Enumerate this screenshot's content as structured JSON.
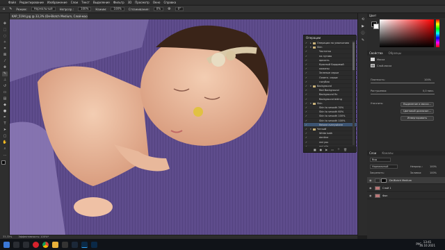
{
  "app": {
    "logo_text": "Ps"
  },
  "menu": [
    "Файл",
    "Редактирование",
    "Изображение",
    "Слои",
    "Текст",
    "Выделение",
    "Фильтр",
    "3D",
    "Просмотр",
    "Окно",
    "Справка"
  ],
  "options": {
    "mode_label": "Режим:",
    "mode_value": "Нормальный",
    "opacity_label": "Непрозр.:",
    "opacity_value": "100%",
    "flow_label": "Нажим:",
    "flow_value": "100%",
    "smooth_label": "Сглаживание:",
    "smooth_value": "0%",
    "angle_value": "0°"
  },
  "document": {
    "tab_title": "KAP_5194.jpg @ 33,3% (De-Blotch Medium, Слой-маска/16) *"
  },
  "status": {
    "zoom": "33,33%",
    "info": "Эффективность: 100%*"
  },
  "actions_panel": {
    "title": "Операции",
    "rows": [
      {
        "label": "Операции по умолчанию",
        "expanded": false,
        "folder": true
      },
      {
        "label": "Skin",
        "expanded": true,
        "folder": true
      },
      {
        "label": "Частотка",
        "expanded": false,
        "folder": false
      },
      {
        "label": "на пугово",
        "expanded": false,
        "folder": false
      },
      {
        "label": "яркость",
        "expanded": false,
        "folder": false
      },
      {
        "label": "Красный Бордовый",
        "expanded": false,
        "folder": false
      },
      {
        "label": "кожаны",
        "expanded": false,
        "folder": false
      },
      {
        "label": "Зеленые серые",
        "expanded": false,
        "folder": false
      },
      {
        "label": "Осветл. серые",
        "expanded": false,
        "folder": false
      },
      {
        "label": "голубая",
        "expanded": false,
        "folder": false
      },
      {
        "label": "Background",
        "expanded": true,
        "folder": true
      },
      {
        "label": "Red Background",
        "expanded": false,
        "folder": false
      },
      {
        "label": "Background fix",
        "expanded": false,
        "folder": false
      },
      {
        "label": "Background biding",
        "expanded": false,
        "folder": false
      },
      {
        "label": "Skin",
        "expanded": true,
        "folder": true
      },
      {
        "label": "Skin to smooth 30%",
        "expanded": false,
        "folder": false
      },
      {
        "label": "Skin to smooth 60%",
        "expanded": false,
        "folder": false
      },
      {
        "label": "Skin to smooth 100%",
        "expanded": false,
        "folder": false
      },
      {
        "label": "Skin to smooth 100%",
        "expanded": false,
        "folder": false
      },
      {
        "label": "Retone everywhere",
        "expanded": false,
        "folder": false,
        "selected": true
      },
      {
        "label": "Четкий",
        "expanded": true,
        "folder": true
      },
      {
        "label": "White bath",
        "expanded": false,
        "folder": false
      },
      {
        "label": "dentine",
        "expanded": false,
        "folder": false
      },
      {
        "label": "red you",
        "expanded": false,
        "folder": false
      },
      {
        "label": "red pile",
        "expanded": false,
        "folder": false
      }
    ]
  },
  "color_panel": {
    "title": "Цвет",
    "fg": "#000000",
    "bg": "#ffffff"
  },
  "properties": {
    "tab1": "Свойства",
    "tab2": "Образцы",
    "mask_label": "Маска",
    "layer_label": "Слой-маска",
    "density_label": "Плотность:",
    "density_value": "100%",
    "feather_label": "Растушевка:",
    "feather_value": "0,0 пикс.",
    "refine_label": "Уточнить:",
    "btn_select": "Выделение и маска...",
    "btn_color": "Цветовой диапазон...",
    "btn_invert": "Инвертировать"
  },
  "layers": {
    "tab1": "Слои",
    "tab2": "Каналы",
    "kind": "Вид",
    "blend": "Нормальный",
    "opacity_label": "Непрозр.:",
    "opacity_value": "100%",
    "fill_label": "Заливка:",
    "fill_value": "100%",
    "lock_label": "Закрепить:",
    "items": [
      {
        "name": "De-Blotch Medium",
        "mask": true
      },
      {
        "name": "Слой 1",
        "mask": false
      },
      {
        "name": "Фон",
        "mask": false
      }
    ]
  },
  "taskbar": {
    "time": "13:41",
    "date": "16.10.2021",
    "lang": "РУС"
  }
}
